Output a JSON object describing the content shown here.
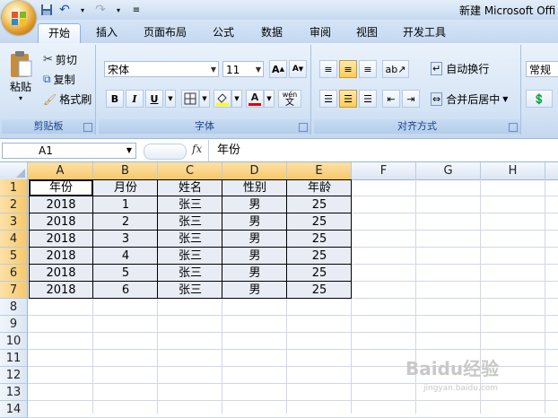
{
  "window": {
    "title": "新建 Microsoft Offi"
  },
  "tabs": [
    "开始",
    "插入",
    "页面布局",
    "公式",
    "数据",
    "审阅",
    "视图",
    "开发工具"
  ],
  "clipboard": {
    "paste": "粘贴",
    "cut": "剪切",
    "copy": "复制",
    "format_painter": "格式刷",
    "label": "剪贴板"
  },
  "font": {
    "name": "宋体",
    "size": "11",
    "bold": "B",
    "italic": "I",
    "underline": "U",
    "grow": "A",
    "shrink": "A",
    "font_color": "A",
    "phonetic": "wén",
    "label": "字体"
  },
  "alignment": {
    "wrap": "自动换行",
    "merge": "合并后居中",
    "label": "对齐方式"
  },
  "number": {
    "format": "常规"
  },
  "formula_bar": {
    "name_box": "A1",
    "fx": "fx",
    "content": "年份"
  },
  "columns": [
    "A",
    "B",
    "C",
    "D",
    "E",
    "F",
    "G",
    "H"
  ],
  "rows": [
    "1",
    "2",
    "3",
    "4",
    "5",
    "6",
    "7",
    "8",
    "9",
    "10",
    "11",
    "12",
    "13",
    "14"
  ],
  "table": {
    "headers": [
      "年份",
      "月份",
      "姓名",
      "性别",
      "年龄"
    ],
    "rows": [
      [
        "2018",
        "1",
        "张三",
        "男",
        "25"
      ],
      [
        "2018",
        "2",
        "张三",
        "男",
        "25"
      ],
      [
        "2018",
        "3",
        "张三",
        "男",
        "25"
      ],
      [
        "2018",
        "4",
        "张三",
        "男",
        "25"
      ],
      [
        "2018",
        "5",
        "张三",
        "男",
        "25"
      ],
      [
        "2018",
        "6",
        "张三",
        "男",
        "25"
      ]
    ]
  },
  "watermark": {
    "brand": "Baidu经验",
    "url": "jingyan.baidu.com"
  }
}
